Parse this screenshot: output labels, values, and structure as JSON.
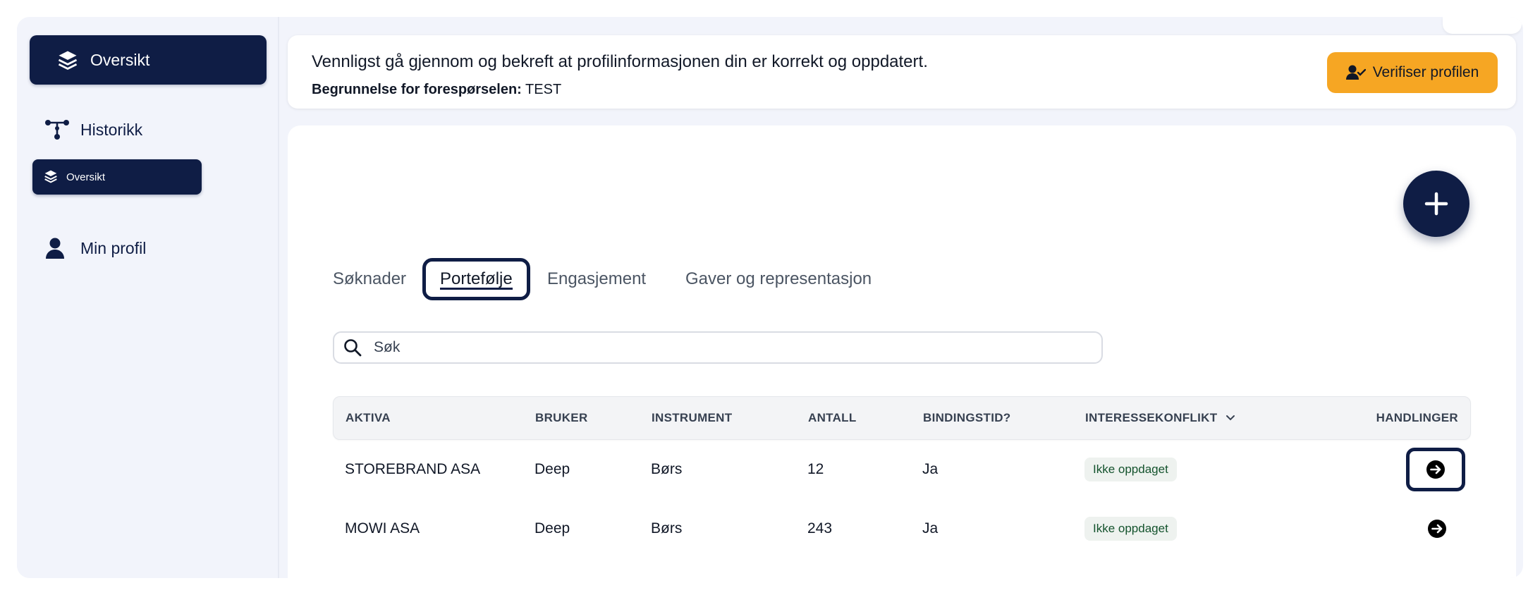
{
  "sidebar": {
    "items": [
      {
        "label": "Oversikt",
        "icon": "layers-icon",
        "active": true
      },
      {
        "label": "Historikk",
        "icon": "flow-icon"
      },
      {
        "label": "Min profil",
        "icon": "person-icon"
      }
    ],
    "tooltip": {
      "label": "Oversikt",
      "icon": "layers-icon"
    }
  },
  "banner": {
    "message": "Vennligst gå gjennom og bekreft at profilinformasjonen din er korrekt og oppdatert.",
    "reason_label": "Begrunnelse for forespørselen:",
    "reason_value": "TEST",
    "verify_button": "Verifiser profilen",
    "verify_icon": "user-check-icon",
    "accent": "#f6a623"
  },
  "main": {
    "add_icon": "plus-icon",
    "tabs": [
      {
        "label": "Søknader"
      },
      {
        "label": "Portefølje",
        "active": true
      },
      {
        "label": "Engasjement"
      },
      {
        "label": "Gaver og representasjon"
      }
    ],
    "search": {
      "placeholder": "Søk",
      "value": ""
    },
    "table": {
      "columns": [
        "AKTIVA",
        "BRUKER",
        "INSTRUMENT",
        "ANTALL",
        "BINDINGSTID?",
        "INTERESSEKONFLIKT",
        "HANDLINGER"
      ],
      "rows": [
        {
          "aktiva": "STOREBRAND ASA",
          "bruker": "Deep",
          "instrument": "Børs",
          "antall": "12",
          "bindingstid": "Ja",
          "interessekonflikt": "Ikke oppdaget"
        },
        {
          "aktiva": "MOWI ASA",
          "bruker": "Deep",
          "instrument": "Børs",
          "antall": "243",
          "bindingstid": "Ja",
          "interessekonflikt": "Ikke oppdaget"
        }
      ]
    }
  },
  "colors": {
    "navy": "#0f1d45",
    "background": "#f2f4fb",
    "badge_text": "#14532d"
  }
}
